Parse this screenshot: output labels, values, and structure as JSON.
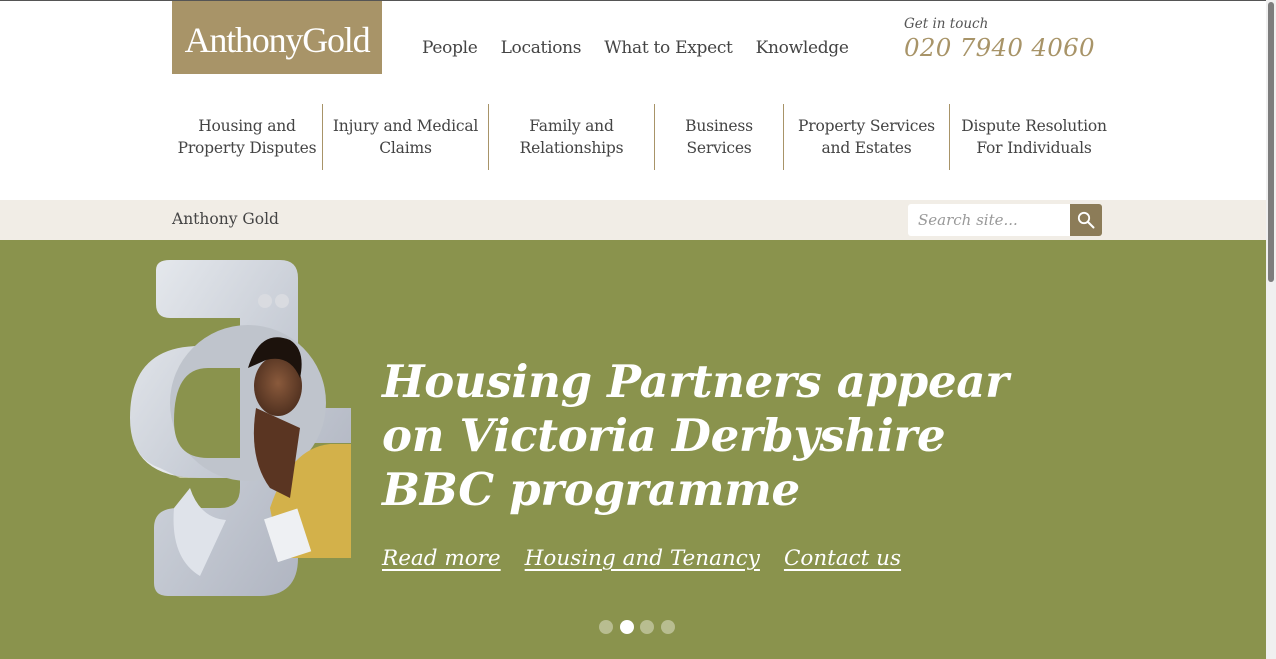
{
  "brand": {
    "logo_text": "AnthonyGold"
  },
  "main_nav": [
    "People",
    "Locations",
    "What to Expect",
    "Knowledge"
  ],
  "contact": {
    "label": "Get in touch",
    "phone": "020 7940 4060"
  },
  "sub_nav": [
    "Housing and Property Disputes",
    "Injury and Medical Claims",
    "Family and Relationships",
    "Business Services",
    "Property Services and Estates",
    "Dispute Resolution For Individuals"
  ],
  "breadcrumb": "Anthony Gold",
  "search": {
    "placeholder": "Search site..."
  },
  "hero": {
    "headline": "Housing Partners appear on Victoria Derbyshire BBC programme",
    "links": [
      "Read more",
      "Housing and Tenancy",
      "Contact us"
    ],
    "slide_count": 4,
    "active_slide": 2
  },
  "colors": {
    "brand_gold": "#a89468",
    "hero_green": "#8a934d",
    "band_bg": "#f1ede6"
  },
  "icons": [
    "search-icon"
  ]
}
